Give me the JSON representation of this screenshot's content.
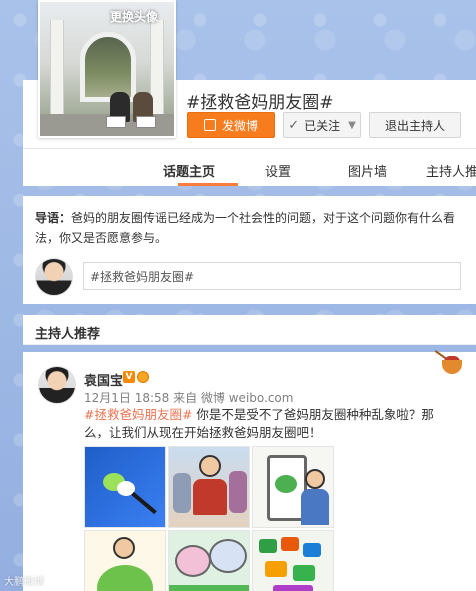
{
  "header": {
    "change_avatar": "更换头像",
    "topic_title": "#拯救爸妈朋友圈#",
    "post_button": "发微博",
    "follow_button": "已关注",
    "exit_host_button": "退出主持人",
    "accent_color": "#f77c1e"
  },
  "tabs": [
    {
      "label": "话题主页",
      "active": true
    },
    {
      "label": "设置"
    },
    {
      "label": "图片墙"
    },
    {
      "label": "主持人推"
    }
  ],
  "intro": {
    "lead_label": "导语：",
    "text": "爸妈的朋友圈传谣已经成为一个社会性的问题，对于这个问题你有什么看法，你又是否愿意参与。"
  },
  "post_box": {
    "value": "#拯救爸妈朋友圈#"
  },
  "host_section": {
    "title": "主持人推荐"
  },
  "feed": {
    "author": "袁国宝",
    "badge": "V",
    "meta": "12月1日 18:58 来自 微博 weibo.com",
    "tag": "#拯救爸妈朋友圈#",
    "text": " 你是不是受不了爸妈朋友圈种种乱象啦？那么，让我们从现在开始拯救爸妈朋友圈吧！"
  },
  "watermark": "大鹏微博"
}
